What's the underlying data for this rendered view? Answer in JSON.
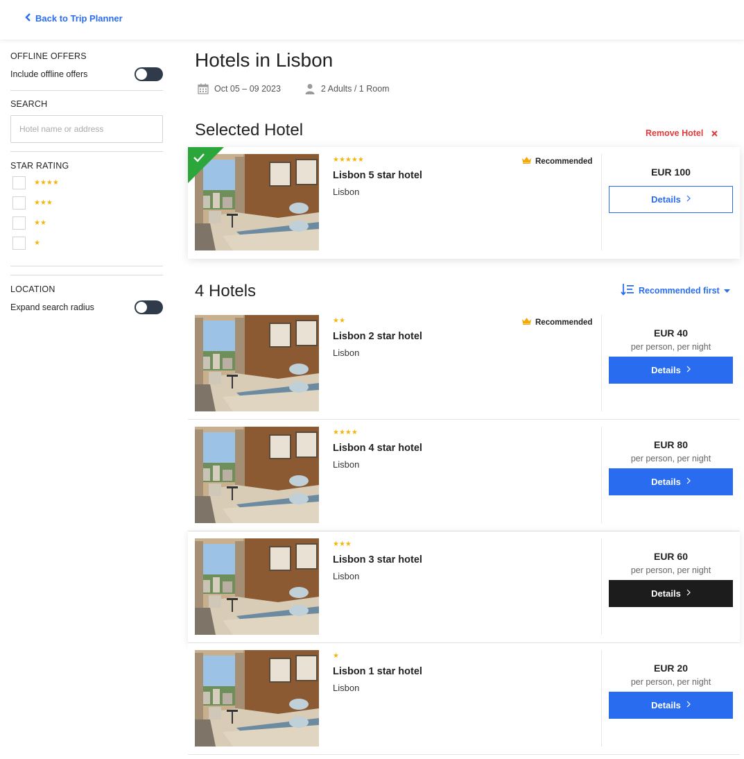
{
  "nav": {
    "back_label": "Back to Trip Planner"
  },
  "sidebar": {
    "offline": {
      "heading": "OFFLINE OFFERS",
      "label": "Include offline offers"
    },
    "search": {
      "heading": "SEARCH",
      "placeholder": "Hotel name or address"
    },
    "star_rating": {
      "heading": "STAR RATING",
      "options": [
        {
          "stars": "★★★★"
        },
        {
          "stars": "★★★"
        },
        {
          "stars": "★★"
        },
        {
          "stars": "★"
        }
      ]
    },
    "location": {
      "heading": "LOCATION",
      "label": "Expand search radius"
    }
  },
  "main": {
    "title": "Hotels in Lisbon",
    "dates": "Oct 05 – 09 2023",
    "guests": "2 Adults / 1 Room",
    "selected_title": "Selected Hotel",
    "remove_label": "Remove Hotel",
    "results_title": "4 Hotels",
    "sort_label": "Recommended first"
  },
  "selected_hotel": {
    "stars": "★★★★★",
    "name": "Lisbon 5 star hotel",
    "city": "Lisbon",
    "badge": "Recommended",
    "price": "EUR 100",
    "button": "Details"
  },
  "hotels": [
    {
      "stars": "★★",
      "name": "Lisbon 2 star hotel",
      "city": "Lisbon",
      "badge": "Recommended",
      "price": "EUR 40",
      "per": "per person, per night",
      "button": "Details"
    },
    {
      "stars": "★★★★",
      "name": "Lisbon 4 star hotel",
      "city": "Lisbon",
      "price": "EUR 80",
      "per": "per person, per night",
      "button": "Details"
    },
    {
      "stars": "★★★",
      "name": "Lisbon 3 star hotel",
      "city": "Lisbon",
      "price": "EUR 60",
      "per": "per person, per night",
      "button": "Details"
    },
    {
      "stars": "★",
      "name": "Lisbon 1 star hotel",
      "city": "Lisbon",
      "price": "EUR 20",
      "per": "per person, per night",
      "button": "Details"
    }
  ],
  "colors": {
    "accent": "#2a6cf0",
    "remove": "#e03a3a",
    "star": "#f3b50c",
    "selected_corner": "#2aa63a",
    "dark_button": "#1c1c1c"
  },
  "icons": [
    "chevron-left-icon",
    "calendar-icon",
    "person-icon",
    "close-icon",
    "sort-icon",
    "crown-icon",
    "check-icon",
    "chevron-right-icon"
  ]
}
